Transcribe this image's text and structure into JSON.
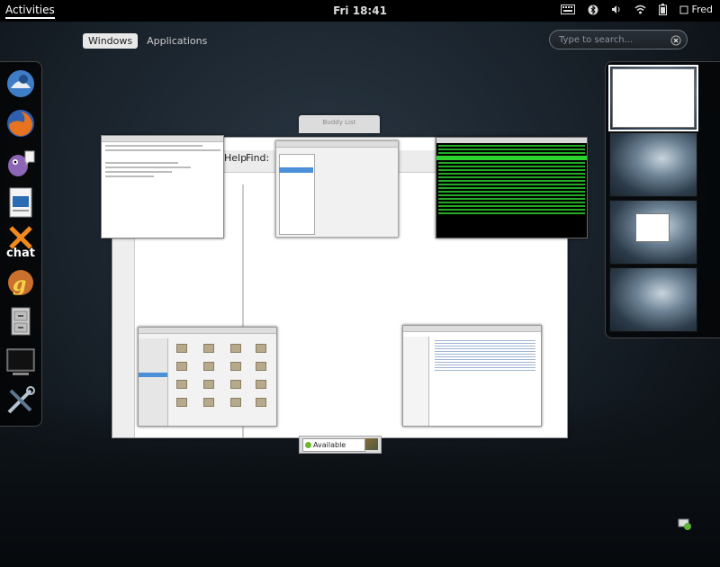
{
  "top_panel": {
    "activities_label": "Activities",
    "clock": "Fri 18:41",
    "user": "Fred",
    "tray_icons": [
      "keyboard-icon",
      "bluetooth-icon",
      "volume-icon",
      "wifi-icon",
      "battery-icon",
      "user-icon"
    ]
  },
  "overview": {
    "tabs": [
      {
        "label": "Windows",
        "active": true
      },
      {
        "label": "Applications",
        "active": false
      }
    ],
    "search_placeholder": "Type to search..."
  },
  "dash": {
    "apps": [
      {
        "name": "Thunderbird",
        "icon": "thunderbird-icon"
      },
      {
        "name": "Firefox",
        "icon": "firefox-icon"
      },
      {
        "name": "Pidgin",
        "icon": "pidgin-icon"
      },
      {
        "name": "LibreOffice Writer",
        "icon": "writer-icon"
      },
      {
        "name": "XChat",
        "icon": "xchat-icon"
      },
      {
        "name": "Gimp",
        "icon": "gimp-icon"
      },
      {
        "name": "File Cabinet",
        "icon": "file-cabinet-icon"
      },
      {
        "name": "Terminal",
        "icon": "terminal-icon"
      },
      {
        "name": "System Tools",
        "icon": "tools-icon"
      }
    ],
    "chat_label": "chat"
  },
  "windows": {
    "main_help": "Help",
    "main_find": "Find:",
    "gnote_title": "Buddy List",
    "status_value": "Available"
  },
  "workspaces": {
    "count": 4,
    "current_index": 0
  },
  "colors": {
    "terminal_green": "#2dd42d",
    "selection_blue": "#4a90d9",
    "available_green": "#6cb52d"
  }
}
